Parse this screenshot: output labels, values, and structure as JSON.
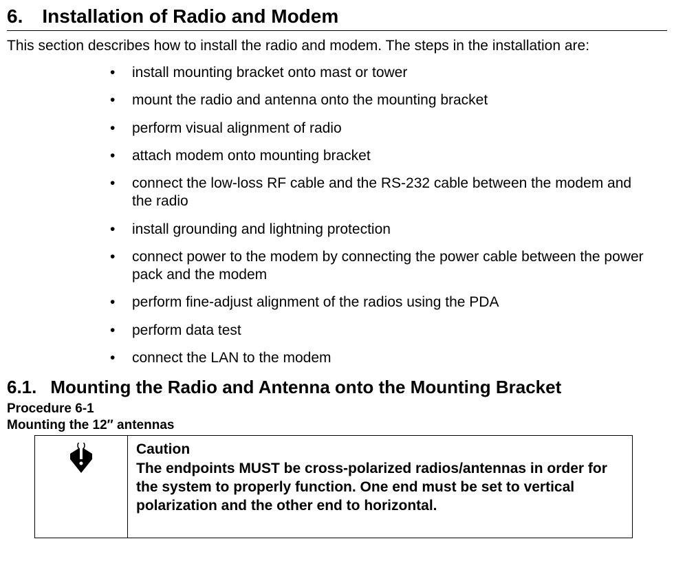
{
  "heading1": {
    "number": "6.",
    "title": "Installation of Radio and Modem"
  },
  "intro": "This section describes how to install the radio and modem. The steps in the installation are:",
  "bullets": {
    "b0": "install mounting bracket onto mast or tower",
    "b1": "mount the radio and antenna onto the mounting bracket",
    "b2": "perform visual alignment of radio",
    "b3": "attach modem onto mounting bracket",
    "b4": "connect the low-loss RF cable and the RS-232 cable between the modem and the radio",
    "b5": "install grounding and lightning protection",
    "b6": "connect power to the modem by connecting the power cable between the power pack and the modem",
    "b7": "perform fine-adjust alignment of the radios using the PDA",
    "b8": "perform data test",
    "b9": "connect the LAN to the modem"
  },
  "heading2": {
    "number": "6.1.",
    "title": "Mounting the Radio and Antenna onto the Mounting Bracket"
  },
  "procedure": {
    "label": "Procedure 6-1",
    "sub": "Mounting the 12″ antennas"
  },
  "caution": {
    "title": "Caution",
    "text": "The endpoints MUST be cross-polarized radios/antennas in order for the system to properly function.  One end must be set to vertical polarization and the other end to horizontal."
  }
}
